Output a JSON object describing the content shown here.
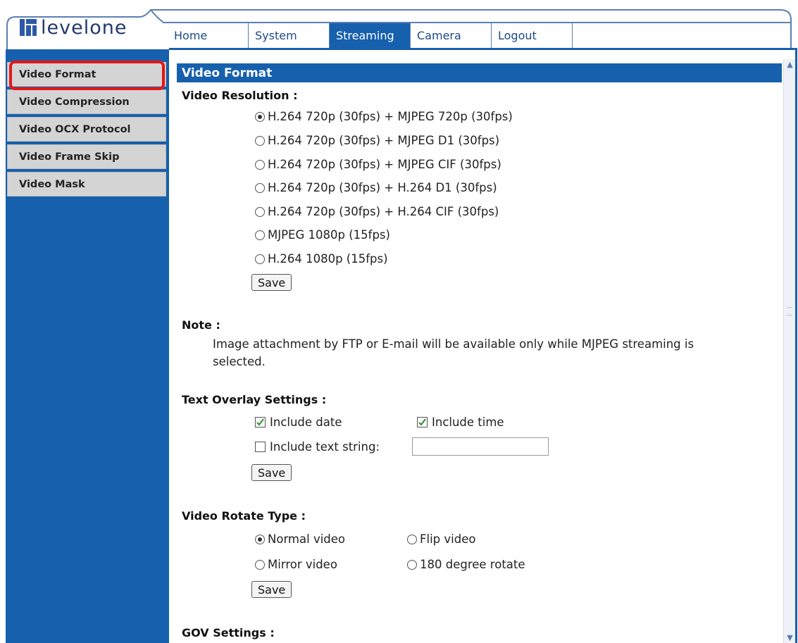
{
  "brand": {
    "logo_text": "levelone"
  },
  "nav": {
    "tabs": [
      {
        "label": "Home",
        "active": false
      },
      {
        "label": "System",
        "active": false
      },
      {
        "label": "Streaming",
        "active": true
      },
      {
        "label": "Camera",
        "active": false
      },
      {
        "label": "Logout",
        "active": false
      }
    ]
  },
  "sidebar": {
    "items": [
      {
        "label": "Video Format",
        "selected": true
      },
      {
        "label": "Video Compression"
      },
      {
        "label": "Video OCX Protocol"
      },
      {
        "label": "Video Frame Skip"
      },
      {
        "label": "Video Mask"
      }
    ]
  },
  "page": {
    "header": "Video Format",
    "resolution": {
      "label": "Video Resolution :",
      "options": [
        {
          "label": "H.264 720p (30fps) + MJPEG 720p (30fps)",
          "selected": true
        },
        {
          "label": "H.264 720p (30fps) + MJPEG D1 (30fps)",
          "selected": false
        },
        {
          "label": "H.264 720p (30fps) + MJPEG CIF (30fps)",
          "selected": false
        },
        {
          "label": "H.264 720p (30fps) + H.264 D1 (30fps)",
          "selected": false
        },
        {
          "label": "H.264 720p (30fps) + H.264 CIF (30fps)",
          "selected": false
        },
        {
          "label": "MJPEG 1080p (15fps)",
          "selected": false
        },
        {
          "label": "H.264 1080p (15fps)",
          "selected": false
        }
      ],
      "save_label": "Save"
    },
    "note": {
      "label": "Note :",
      "text": "Image attachment by FTP or E-mail will be available only while MJPEG streaming is selected."
    },
    "overlay": {
      "label": "Text Overlay Settings :",
      "include_date": {
        "label": "Include date",
        "checked": true
      },
      "include_time": {
        "label": "Include time",
        "checked": true
      },
      "include_text": {
        "label": "Include text string:",
        "checked": false,
        "value": ""
      },
      "save_label": "Save"
    },
    "rotate": {
      "label": "Video Rotate Type :",
      "options": [
        {
          "label": "Normal video",
          "selected": true
        },
        {
          "label": "Flip video",
          "selected": false
        },
        {
          "label": "Mirror video",
          "selected": false
        },
        {
          "label": "180 degree rotate",
          "selected": false
        }
      ],
      "save_label": "Save"
    },
    "gov": {
      "label": "GOV Settings :"
    }
  },
  "colors": {
    "brand_blue": "#1760ad",
    "highlight": "#e61616"
  },
  "icons": {
    "logo": "levelone-logo-icon",
    "scroll_up": "chevron-up-icon",
    "scroll_down": "chevron-down-icon"
  }
}
